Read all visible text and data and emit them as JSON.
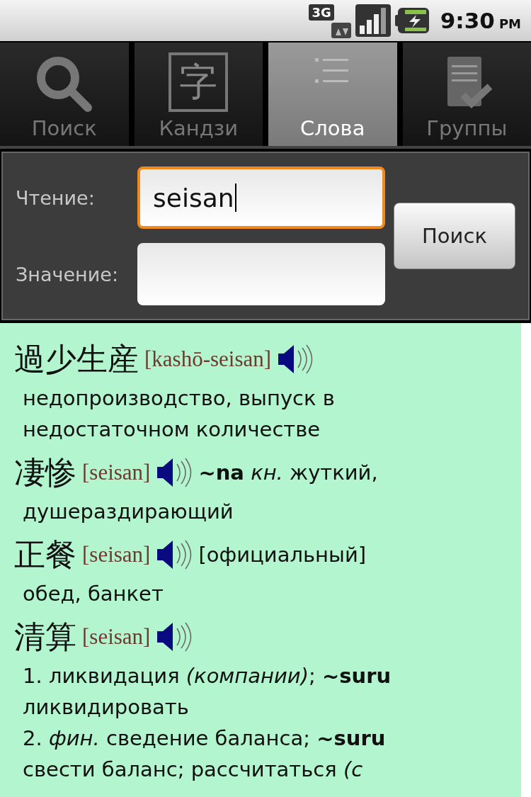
{
  "status_bar": {
    "network": "3G",
    "time": "9:30",
    "ampm": "PM"
  },
  "tabs": [
    {
      "label": "Поиск",
      "kind": "search",
      "selected": false
    },
    {
      "label": "Кандзи",
      "kind": "kanji",
      "icon_text": "字",
      "selected": false
    },
    {
      "label": "Слова",
      "kind": "list",
      "selected": true
    },
    {
      "label": "Группы",
      "kind": "checklist",
      "selected": false
    }
  ],
  "form": {
    "reading_label": "Чтение:",
    "reading_value": "seisan",
    "meaning_label": "Значение:",
    "search_button": "Поиск"
  },
  "results": [
    {
      "headword": "過少生産",
      "reading": "[kashō-seisan]",
      "lines": [
        "недопроизводство, выпуск в",
        "недостаточном количестве"
      ]
    },
    {
      "headword": "凄惨",
      "reading": "[seisan]",
      "note": "**~na** *кн.* жуткий,",
      "lines": [
        "душераздирающий"
      ]
    },
    {
      "headword": "正餐",
      "reading": "[seisan]",
      "note": "[официальный]",
      "lines": [
        "обед, банкет"
      ]
    },
    {
      "headword": "清算",
      "reading": "[seisan]",
      "lines": [
        "1. ликвидация *(компании)*; **~suru**",
        "ликвидировать",
        "2. *фин.* сведение баланса; **~suru**",
        "свести баланс; рассчитаться *(с*"
      ]
    }
  ]
}
